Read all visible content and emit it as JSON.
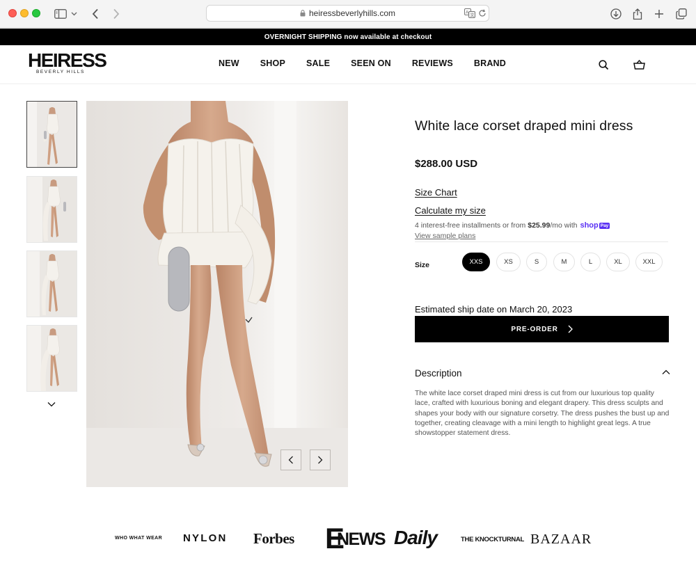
{
  "browser": {
    "url": "heiressbeverlyhills.com"
  },
  "announcement": {
    "text": "OVERNIGHT SHIPPING now available at checkout"
  },
  "header": {
    "logo_main": "HEIRESS",
    "logo_sub": "BEVERLY HILLS",
    "nav": [
      "NEW",
      "SHOP",
      "SALE",
      "SEEN ON",
      "REVIEWS",
      "BRAND"
    ],
    "icons": [
      "search-icon",
      "cart-icon"
    ]
  },
  "gallery": {
    "thumbnail_count": 4,
    "active_thumbnail": 1
  },
  "product": {
    "title": "White lace corset draped mini dress",
    "price": "$288.00 USD",
    "size_chart_label": "Size Chart",
    "calc_size_label": "Calculate my size",
    "installments_prefix": "4 interest-free installments or from",
    "installments_amount": "$25.99",
    "installments_suffix": "/mo with",
    "shop_logo": "shop",
    "pay_badge": "Pay",
    "sample_plans_label": "View sample plans",
    "size_label": "Size",
    "sizes": [
      "XXS",
      "XS",
      "S",
      "M",
      "L",
      "XL",
      "XXL"
    ],
    "selected_size": "XXS",
    "ship_date": "Estimated ship date on March 20, 2023",
    "preorder_label": "PRE-ORDER",
    "description_title": "Description",
    "description_body": "The white lace corset draped mini dress is cut from our luxurious top quality lace, crafted with luxurious boning and elegant drapery. This dress sculpts and shapes your body with our signature corsetry. The dress pushes the bust up and together, creating cleavage with a mini length to highlight great legs. A true showstopper statement dress."
  },
  "press": {
    "logos": [
      "WHO WHAT WEAR",
      "NYLON",
      "Forbes",
      "E",
      "NEWS",
      "Daily",
      "THE KNOCKTURNAL",
      "BAZAAR"
    ]
  },
  "colors": {
    "black": "#000000",
    "shop_pay": "#5a31f4",
    "image_background": "#ece9e6"
  }
}
